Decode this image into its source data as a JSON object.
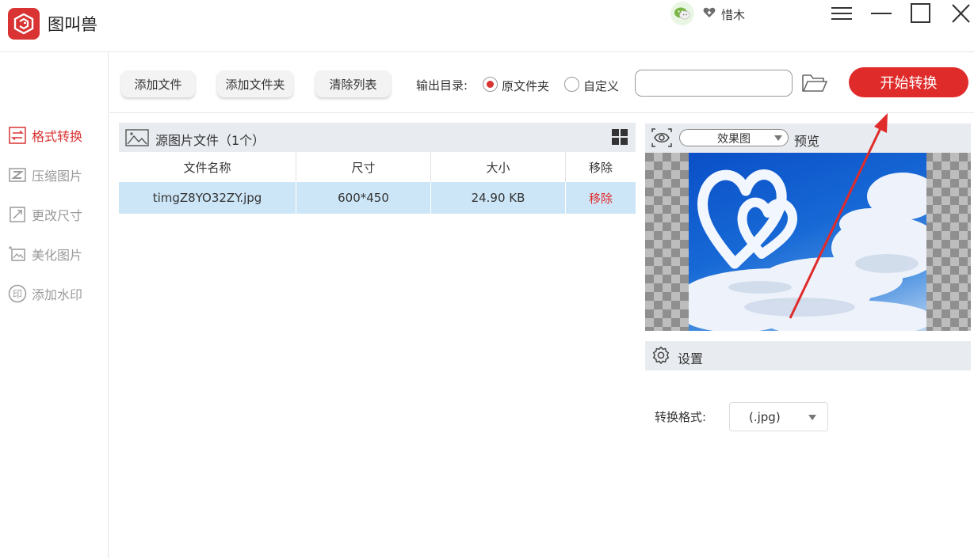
{
  "app": {
    "title": "图叫兽",
    "username": "惜木"
  },
  "icons": {
    "logo": "app-logo-icon",
    "wechat": "wechat-icon",
    "heart": "heart-icon",
    "menu": "menu-icon",
    "minimize": "minimize-icon",
    "maximize": "maximize-icon",
    "close": "close-icon",
    "folder": "folder-open-icon",
    "grid": "grid-view-icon",
    "eye": "eye-icon",
    "gear": "gear-icon"
  },
  "colors": {
    "accent": "#e02b2b",
    "selected_row": "#cde6f7",
    "panel_header": "#e8ebef"
  },
  "sidebar": {
    "items": [
      {
        "label": "格式转换",
        "icon": "convert-icon",
        "active": true
      },
      {
        "label": "压缩图片",
        "icon": "compress-icon",
        "active": false
      },
      {
        "label": "更改尺寸",
        "icon": "resize-icon",
        "active": false
      },
      {
        "label": "美化图片",
        "icon": "beautify-icon",
        "active": false
      },
      {
        "label": "添加水印",
        "icon": "watermark-icon",
        "active": false
      }
    ]
  },
  "toolbar": {
    "add_file": "添加文件",
    "add_folder": "添加文件夹",
    "clear_list": "清除列表",
    "output_dir_label": "输出目录:",
    "option_original": "原文件夹",
    "option_custom": "自定义",
    "selected_option": "原文件夹",
    "path_value": "",
    "start": "开始转换"
  },
  "file_panel": {
    "title": "源图片文件（1个）",
    "columns": [
      "文件名称",
      "尺寸",
      "大小",
      "移除"
    ],
    "rows": [
      {
        "name": "timgZ8YO32ZY.jpg",
        "size": "600*450",
        "filesize": "24.90 KB",
        "remove": "移除"
      }
    ]
  },
  "preview": {
    "view_mode": "效果图",
    "label": "预览"
  },
  "settings": {
    "title": "设置",
    "format_label": "转换格式:",
    "format_value": "(.jpg)"
  }
}
